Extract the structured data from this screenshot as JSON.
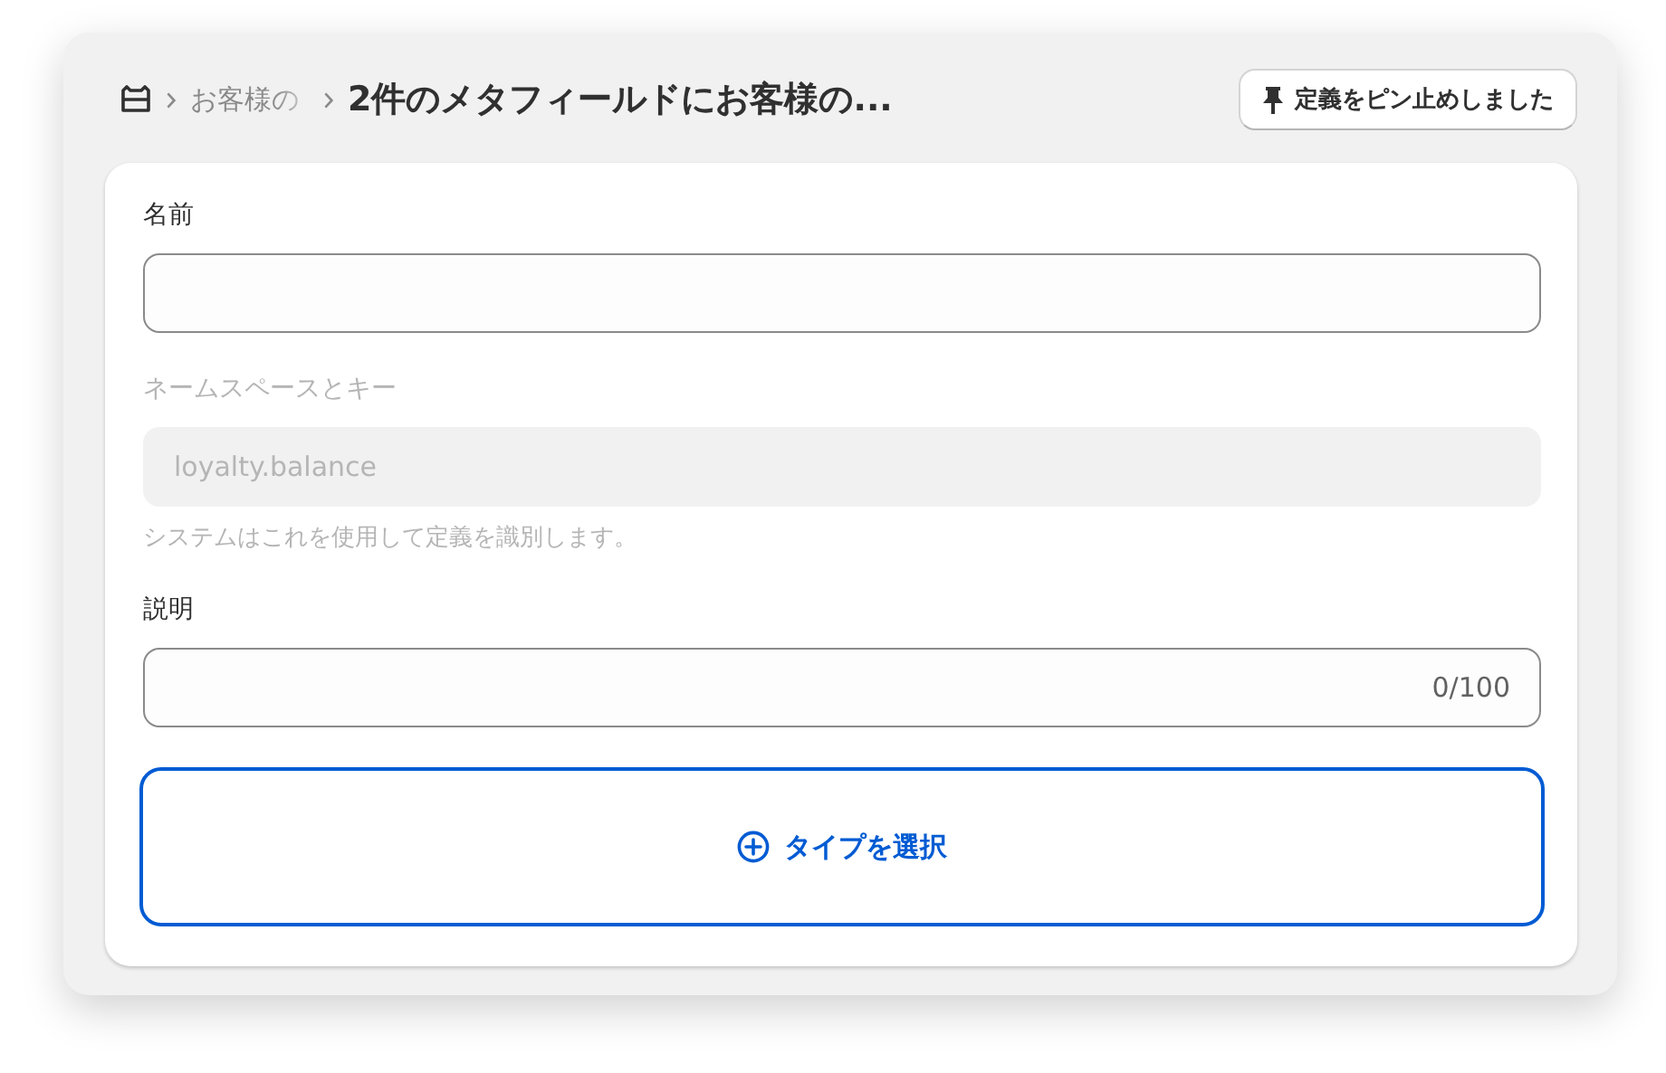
{
  "breadcrumb": {
    "items": [
      "お客様の"
    ],
    "title": "2件のメタフィールドにお客様の..."
  },
  "pin_button": {
    "label": "定義をピン止めしました"
  },
  "fields": [
    {
      "kind": "text",
      "label": "名前",
      "disabled": false
    },
    {
      "kind": "text",
      "label": "ネームスペースとキー",
      "value": "loyalty.balance",
      "help": "システムはこれを使用して定義を識別します。",
      "disabled": true
    },
    {
      "kind": "counter",
      "label": "説明",
      "counter": "0/100",
      "disabled": false
    }
  ],
  "type_button": {
    "label": "タイプを選択",
    "focused": true
  }
}
